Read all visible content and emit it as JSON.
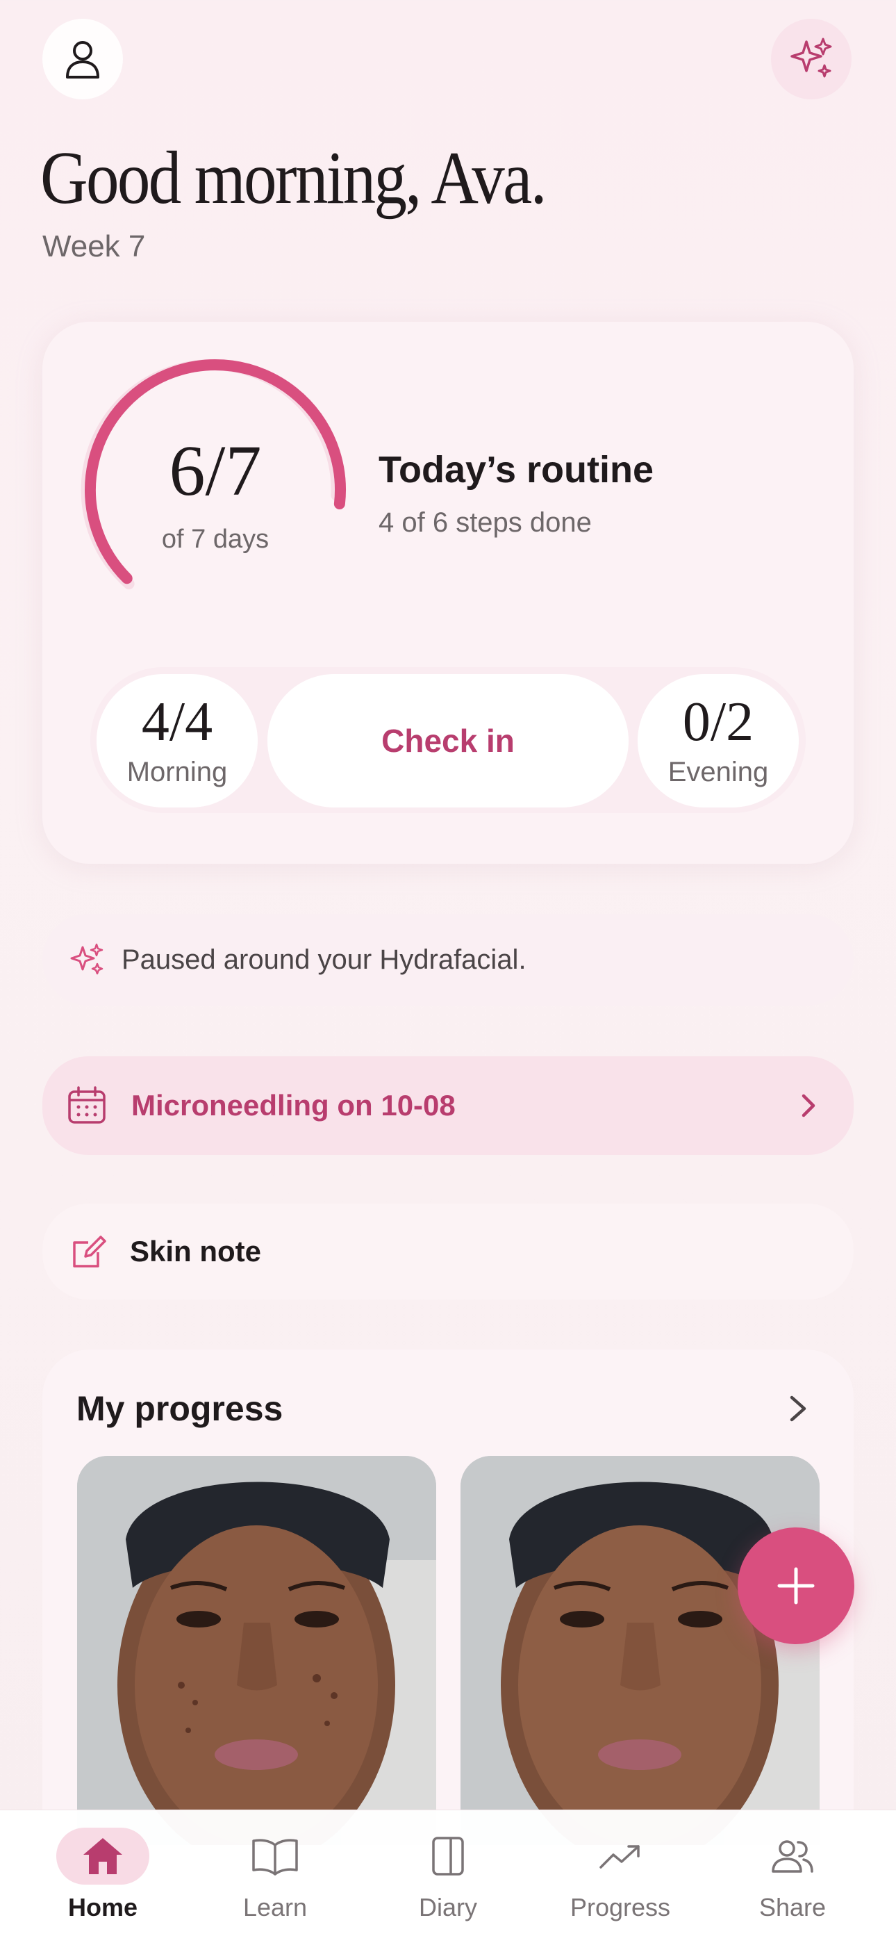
{
  "header": {
    "greeting": "Good morning, Ava.",
    "week": "Week 7",
    "profile_icon": "person-icon",
    "sparkle_icon": "sparkles-icon"
  },
  "routine_card": {
    "streak_value": "6/7",
    "streak_label": "of 7 days",
    "streak_fraction": 0.857,
    "title": "Today’s routine",
    "subtitle": "4 of 6 steps done",
    "morning": {
      "value": "4/4",
      "label": "Morning"
    },
    "checkin_label": "Check in",
    "evening": {
      "value": "0/2",
      "label": "Evening"
    }
  },
  "notices": {
    "pause_text": "Paused around your Hydrafacial.",
    "appointment_text": "Microneedling on 10-08",
    "note_text": "Skin note"
  },
  "progress": {
    "title": "My progress"
  },
  "tabs": [
    {
      "label": "Home",
      "icon": "home-icon",
      "active": true
    },
    {
      "label": "Learn",
      "icon": "book-icon",
      "active": false
    },
    {
      "label": "Diary",
      "icon": "notebook-icon",
      "active": false
    },
    {
      "label": "Progress",
      "icon": "trend-up-icon",
      "active": false
    },
    {
      "label": "Share",
      "icon": "people-icon",
      "active": false
    }
  ],
  "colors": {
    "accent": "#d94f7f",
    "accent_text": "#b83d6e",
    "background": "#fbeef2"
  }
}
